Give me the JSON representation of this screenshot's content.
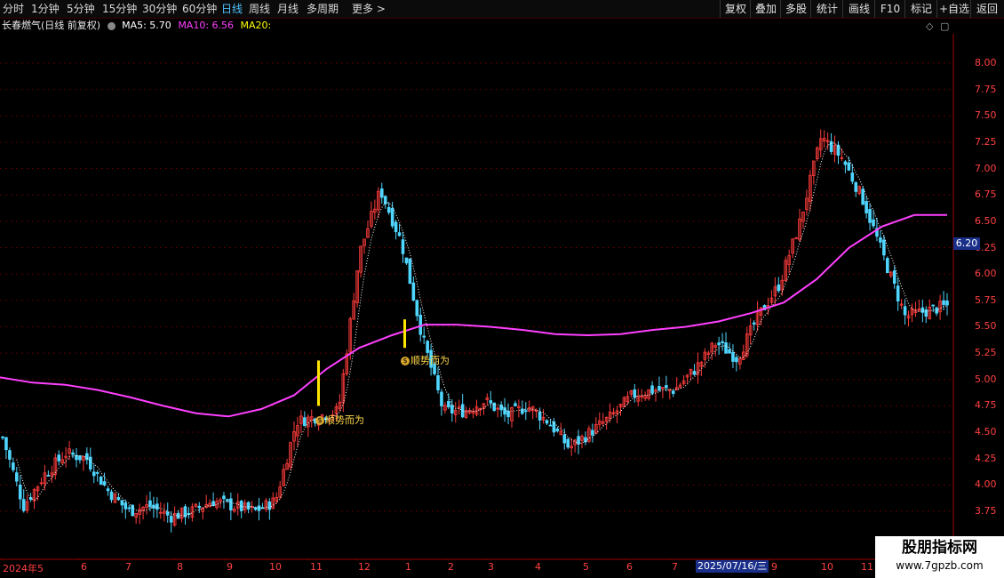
{
  "toolbar": {
    "periods": [
      {
        "label": "分时",
        "active": false
      },
      {
        "label": "1分钟",
        "active": false
      },
      {
        "label": "5分钟",
        "active": false
      },
      {
        "label": "15分钟",
        "active": false
      },
      {
        "label": "30分钟",
        "active": false
      },
      {
        "label": "60分钟",
        "active": false
      },
      {
        "label": "日线",
        "active": true
      },
      {
        "label": "周线",
        "active": false
      },
      {
        "label": "月线",
        "active": false
      },
      {
        "label": "多周期",
        "active": false
      },
      {
        "label": "更多 >",
        "active": false
      }
    ],
    "right_buttons": [
      "复权",
      "叠加",
      "多股",
      "统计",
      "画线",
      "F10",
      "标记",
      "+自选",
      "返回"
    ]
  },
  "info": {
    "stock": "长春燃气(日线 前复权)",
    "ma5_label": "MA5: 5.70",
    "ma10_label": "MA10: 6.56",
    "ma20_label": "MA20:",
    "colors": {
      "ma5": "#ffffff",
      "ma10": "#ff40ff",
      "ma20": "#ffff00"
    }
  },
  "y_axis": [
    "8.00",
    "7.75",
    "7.50",
    "7.25",
    "7.00",
    "6.75",
    "6.50",
    "6.25",
    "6.00",
    "5.75",
    "5.50",
    "5.25",
    "5.00",
    "4.75",
    "4.50",
    "4.25",
    "4.00",
    "3.75"
  ],
  "current_price": "6.20",
  "x_axis": [
    "2024年5",
    "6",
    "7",
    "8",
    "9",
    "10",
    "11",
    "12",
    "1",
    "2",
    "3",
    "4",
    "5",
    "6",
    "7",
    "9",
    "10",
    "11"
  ],
  "cursor_date": "2025/07/16/三",
  "signals": [
    {
      "label": "顺势而为"
    },
    {
      "label": "顺势而为"
    }
  ],
  "signal_icon": "money-bag-icon",
  "watermark": {
    "title": "股朋指标网",
    "url": "www.7gpzb.com"
  },
  "chart_data": {
    "type": "candlestick",
    "ylim": [
      3.6,
      8.2
    ],
    "ma_long_color": "#ff40ff",
    "x_ticks": [
      "2024年5",
      "6",
      "7",
      "8",
      "9",
      "10",
      "11",
      "12",
      "1",
      "2",
      "3",
      "4",
      "5",
      "6",
      "7",
      "9",
      "10",
      "11"
    ],
    "ma_long": [
      5.02,
      4.97,
      4.95,
      4.9,
      4.83,
      4.75,
      4.68,
      4.65,
      4.72,
      4.85,
      5.1,
      5.3,
      5.42,
      5.52,
      5.52,
      5.5,
      5.47,
      5.43,
      5.42,
      5.43,
      5.47,
      5.5,
      5.55,
      5.63,
      5.73,
      5.95,
      6.25,
      6.45,
      6.56,
      6.56
    ],
    "closes": [
      4.45,
      3.8,
      4.1,
      4.3,
      4.25,
      3.95,
      3.75,
      3.8,
      3.7,
      3.75,
      3.85,
      3.8,
      3.75,
      3.85,
      4.6,
      4.65,
      4.7,
      6.2,
      6.8,
      6.3,
      5.4,
      4.7,
      4.7,
      4.8,
      4.65,
      4.75,
      4.6,
      4.35,
      4.5,
      4.65,
      4.85,
      4.9,
      4.9,
      5.1,
      5.35,
      5.2,
      5.6,
      5.9,
      6.5,
      7.3,
      7.1,
      6.7,
      6.15,
      5.6,
      5.65,
      5.7
    ]
  }
}
